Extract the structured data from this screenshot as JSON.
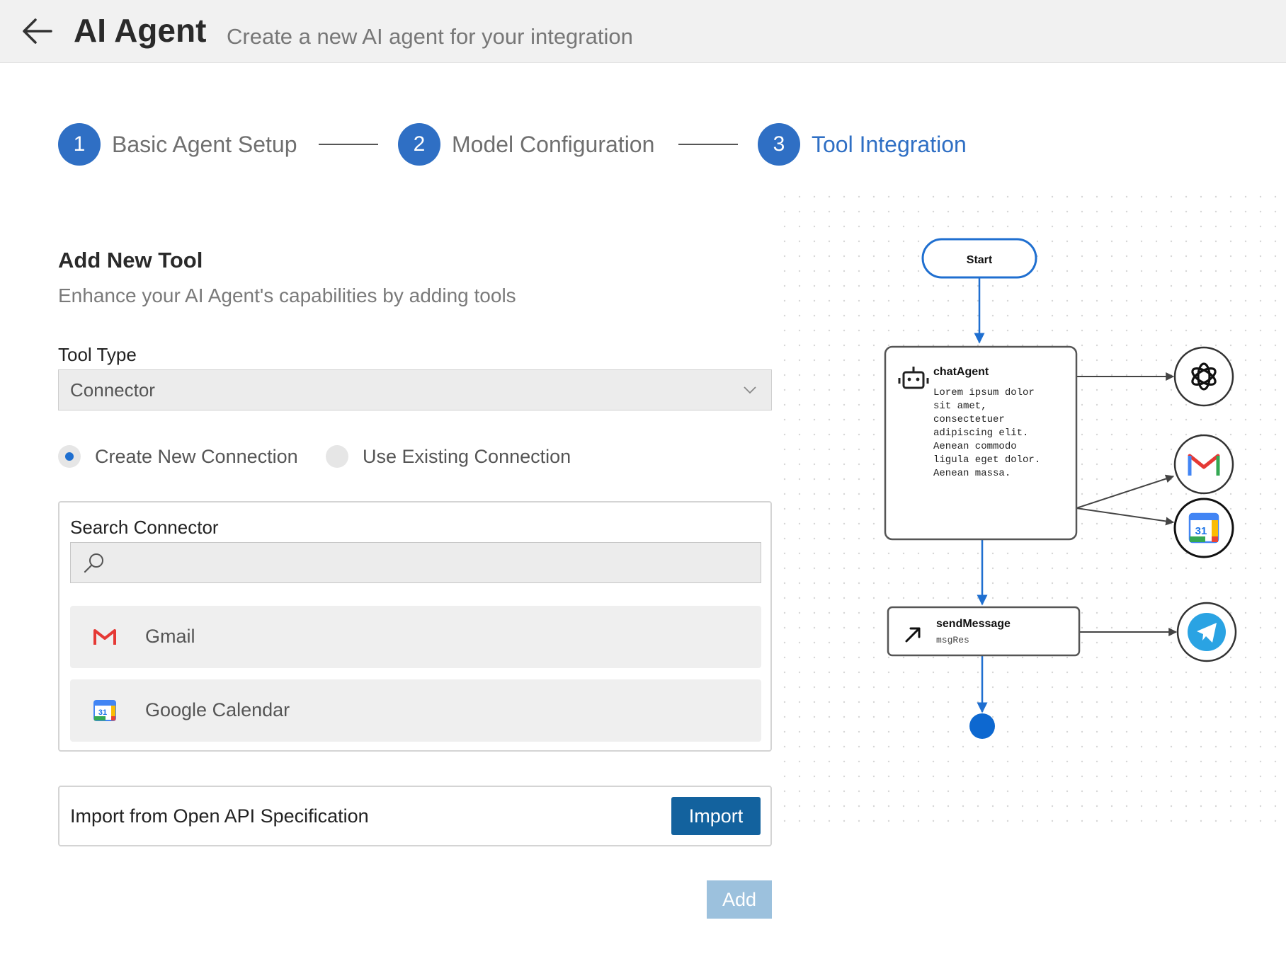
{
  "header": {
    "title": "AI Agent",
    "subtitle": "Create a new AI agent for your integration"
  },
  "steps": [
    {
      "number": "1",
      "label": "Basic Agent Setup"
    },
    {
      "number": "2",
      "label": "Model Configuration"
    },
    {
      "number": "3",
      "label": "Tool Integration",
      "active": true
    }
  ],
  "form": {
    "title": "Add New Tool",
    "subtitle": "Enhance your AI Agent's capabilities by adding tools",
    "tool_type_label": "Tool Type",
    "tool_type_value": "Connector",
    "radio_create": "Create New Connection",
    "radio_existing": "Use Existing Connection",
    "radio_selected": "create",
    "search_label": "Search Connector",
    "search_value": "",
    "connectors": [
      {
        "label": "Gmail",
        "icon": "gmail-icon"
      },
      {
        "label": "Google Calendar",
        "icon": "google-calendar-icon"
      }
    ],
    "import_label": "Import from Open API Specification",
    "import_button": "Import",
    "add_button": "Add"
  },
  "diagram": {
    "start_label": "Start",
    "agent_title": "chatAgent",
    "agent_text": [
      "Lorem ipsum dolor",
      "sit amet,",
      "consectetuer",
      "adipiscing elit.",
      "Aenean commodo",
      "ligula eget dolor.",
      "Aenean massa."
    ],
    "send_title": "sendMessage",
    "send_sub": "msgRes",
    "calendar_day": "31",
    "tools": [
      "openai-icon",
      "gmail-icon",
      "google-calendar-icon",
      "telegram-icon"
    ]
  },
  "colors": {
    "accent": "#2f6fc4",
    "flow_line": "#1f6fd0",
    "import_button": "#13629e",
    "add_button_disabled": "#9cc1dd",
    "header_bg": "#f1f1f1"
  }
}
